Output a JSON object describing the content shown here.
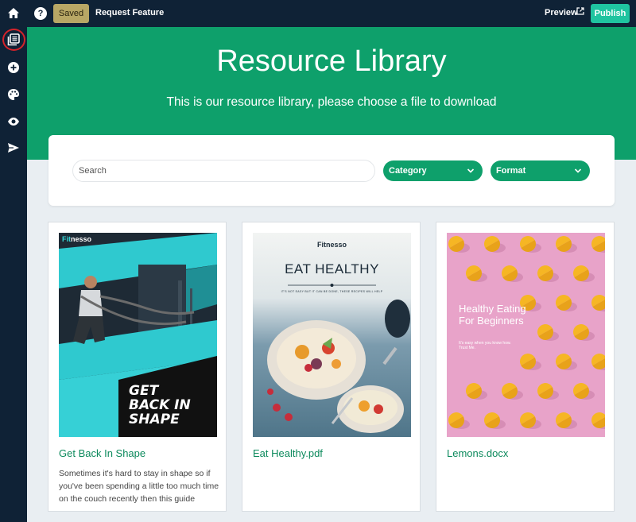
{
  "topbar": {
    "saved_label": "Saved",
    "request_feature": "Request Feature",
    "preview_label": "Preview",
    "publish_label": "Publish",
    "help_glyph": "?",
    "icons": [
      "home-icon",
      "help-icon",
      "external-link-icon"
    ]
  },
  "sidebar": {
    "items": [
      {
        "icon": "pages-icon",
        "highlighted": true
      },
      {
        "icon": "add-icon"
      },
      {
        "icon": "palette-icon"
      },
      {
        "icon": "eye-icon"
      },
      {
        "icon": "send-icon"
      }
    ]
  },
  "hero": {
    "title": "Resource Library",
    "subtitle": "This is our resource library, please choose a file to download"
  },
  "filters": {
    "search_placeholder": "Search",
    "category_label": "Category",
    "format_label": "Format"
  },
  "resources": [
    {
      "title": "Get Back In Shape",
      "description": "Sometimes it's hard to stay in shape so if you've been spending a little too much time on the couch recently then this guide",
      "cover": {
        "brand_prefix": "Fit",
        "brand_suffix": "nesso",
        "headline": [
          "GET",
          "BACK IN",
          "SHAPE"
        ]
      }
    },
    {
      "title": "Eat Healthy.pdf",
      "description": "",
      "cover": {
        "brand": "Fitnesso",
        "headline": "EAT HEALTHY",
        "tagline": "IT'S NOT EASY BUT IT CAN BE DONE, THESE RECIPES WILL HELP"
      }
    },
    {
      "title": "Lemons.docx",
      "description": "",
      "cover": {
        "headline": "Healthy Eating For Beginners",
        "sub": "It's easy when you know how. Trust Me."
      }
    }
  ],
  "colors": {
    "nav_bg": "#0f2236",
    "brand_green": "#0ea06b",
    "publish": "#1fc4a0",
    "saved": "#b8a765",
    "highlight_red": "#d5232a"
  }
}
